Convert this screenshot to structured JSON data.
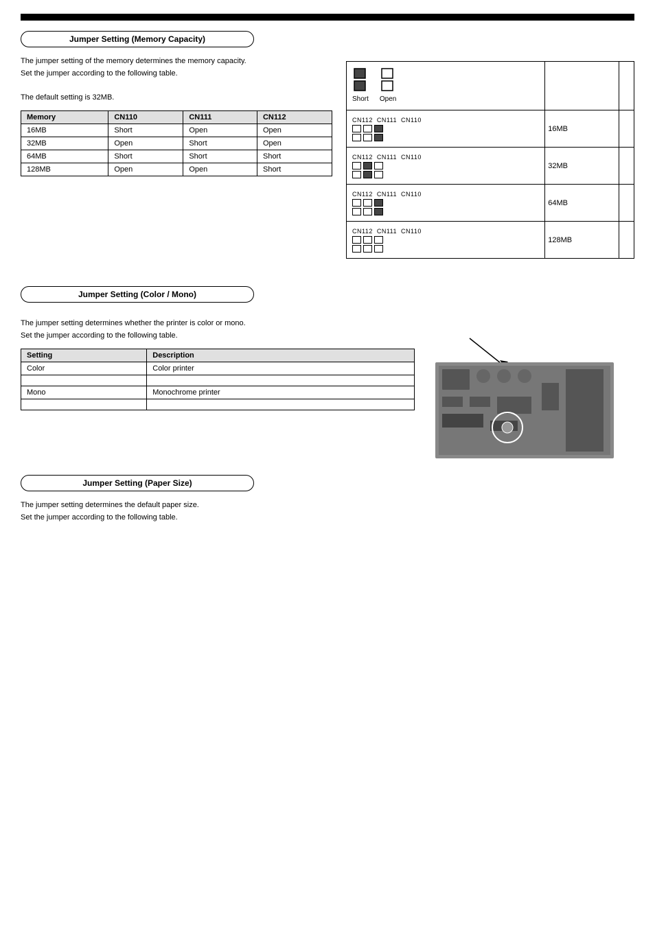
{
  "page": {
    "top_bar": true
  },
  "section1": {
    "header": "Jumper Setting (Memory Capacity)",
    "body_lines": [
      "The jumper setting of the memory determines the memory capacity.",
      "Set the jumper according to the following table.",
      "",
      "The default setting is 32MB."
    ],
    "table": {
      "headers": [
        "Memory",
        "CN110",
        "CN111",
        "CN112"
      ],
      "rows": [
        [
          "16MB",
          "Short",
          "Open",
          "Open"
        ],
        [
          "32MB",
          "Open",
          "Short",
          "Open"
        ],
        [
          "64MB",
          "Short",
          "Short",
          "Short"
        ],
        [
          "128MB",
          "Open",
          "Open",
          "Short"
        ]
      ]
    },
    "jumper_legend": {
      "short_label": "Short",
      "open_label": "Open"
    },
    "jumper_rows": [
      {
        "cn_states": [
          {
            "name": "CN112",
            "top": "open",
            "bot": "open"
          },
          {
            "name": "CN111",
            "top": "open",
            "bot": "open"
          },
          {
            "name": "CN110",
            "top": "short",
            "bot": "short"
          }
        ],
        "setting": "16MB"
      },
      {
        "cn_states": [
          {
            "name": "CN112",
            "top": "open",
            "bot": "open"
          },
          {
            "name": "CN111",
            "top": "short",
            "bot": "short"
          },
          {
            "name": "CN110",
            "top": "open",
            "bot": "open"
          }
        ],
        "setting": "32MB"
      },
      {
        "cn_states": [
          {
            "name": "CN112",
            "top": "open",
            "bot": "open"
          },
          {
            "name": "CN111",
            "top": "open",
            "bot": "open"
          },
          {
            "name": "CN110",
            "top": "short",
            "bot": "short"
          }
        ],
        "setting": "64MB"
      },
      {
        "cn_states": [
          {
            "name": "CN112",
            "top": "open",
            "bot": "open"
          },
          {
            "name": "CN111",
            "top": "open",
            "bot": "open"
          },
          {
            "name": "CN110",
            "top": "open",
            "bot": "open"
          }
        ],
        "setting": "128MB"
      }
    ]
  },
  "section2": {
    "header": "Jumper Setting (Color / Mono)",
    "body_lines": [
      "The jumper setting determines whether the printer is color or mono.",
      "Set the jumper according to the following table."
    ],
    "table": {
      "headers": [
        "Setting",
        "Description"
      ],
      "rows": [
        [
          "Color",
          "Color printer"
        ],
        [
          "",
          ""
        ],
        [
          "Mono",
          "Monochrome printer"
        ],
        [
          "",
          ""
        ]
      ]
    }
  },
  "section3": {
    "header": "Jumper Setting (Paper Size)",
    "body_lines": [
      "The jumper setting determines the default paper size.",
      "Set the jumper according to the following table."
    ]
  },
  "jumper_symbols": {
    "short": "Short",
    "open": "Open"
  }
}
